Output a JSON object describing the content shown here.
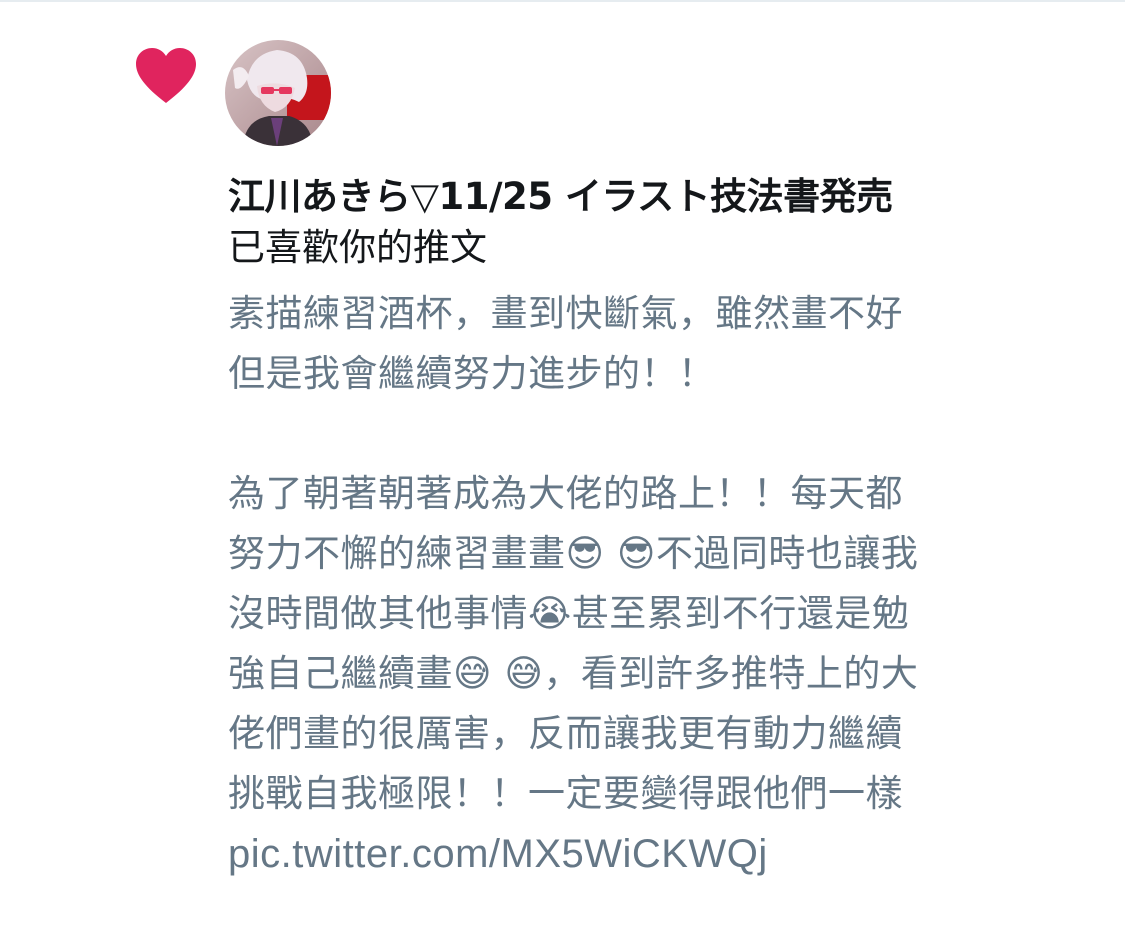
{
  "colors": {
    "heart": "#e0245e",
    "text_primary": "#14171a",
    "text_secondary": "#657786",
    "divider": "#e6ecf0"
  },
  "notification": {
    "icon": "heart-icon",
    "avatar": "user-avatar",
    "user_name": "江川あきら▽11/25 イラスト技法書発売",
    "action": "已喜歡你的推文",
    "tweet_lines": [
      "素描練習酒杯，畫到快斷氣，雖然畫不好",
      "但是我會繼續努力進步的！！",
      "",
      "為了朝著朝著成為大佬的路上！！每天都",
      "努力不懈的練習畫畫😎 😎不過同時也讓我",
      "沒時間做其他事情😭甚至累到不行還是勉",
      "強自己繼續畫😅 😅，看到許多推特上的大",
      "佬們畫的很厲害，反而讓我更有動力繼續",
      "挑戰自我極限！！一定要變得跟他們一樣"
    ],
    "tweet_link": "pic.twitter.com/MX5WiCKWQj"
  }
}
